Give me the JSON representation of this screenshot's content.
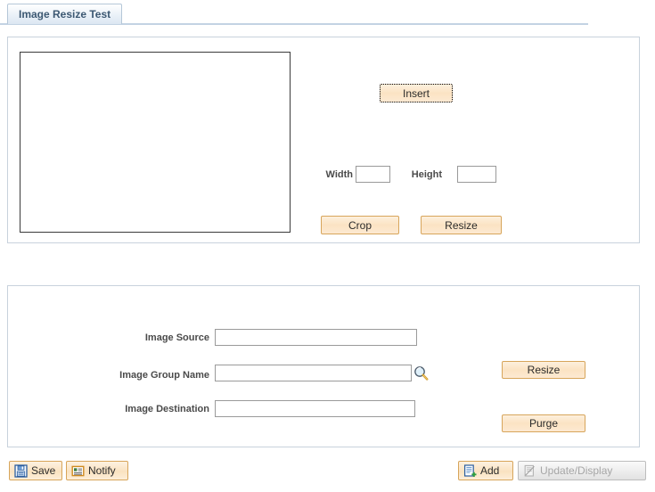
{
  "page": {
    "tab_label": "Image Resize Test"
  },
  "image_panel": {
    "preview_name": "image-preview-area",
    "insert_label": "Insert",
    "width_label": "Width",
    "width_value": "",
    "height_label": "Height",
    "height_value": "",
    "crop_label": "Crop",
    "resize_label": "Resize"
  },
  "fields_panel": {
    "image_source_label": "Image Source",
    "image_source_value": "",
    "image_group_label": "Image Group Name",
    "image_group_value": "",
    "lookup_icon": "magnifier-lookup-icon",
    "image_destination_label": "Image Destination",
    "image_destination_value": "",
    "resize_label": "Resize",
    "purge_label": "Purge"
  },
  "toolbar": {
    "save_label": "Save",
    "save_icon": "floppy-disk-icon",
    "notify_label": "Notify",
    "notify_icon": "notify-memo-icon",
    "add_label": "Add",
    "add_icon": "document-plus-icon",
    "update_display_label": "Update/Display",
    "update_display_icon": "update-display-icon",
    "update_display_disabled": true
  },
  "colors": {
    "button_border": "#d7a55b",
    "button_fill": "#fae2c0",
    "tab_text": "#3c5872",
    "groupbox_border": "#c8d2dc",
    "label_text": "#4a4a4a",
    "disabled_text": "#a6a6a6"
  }
}
